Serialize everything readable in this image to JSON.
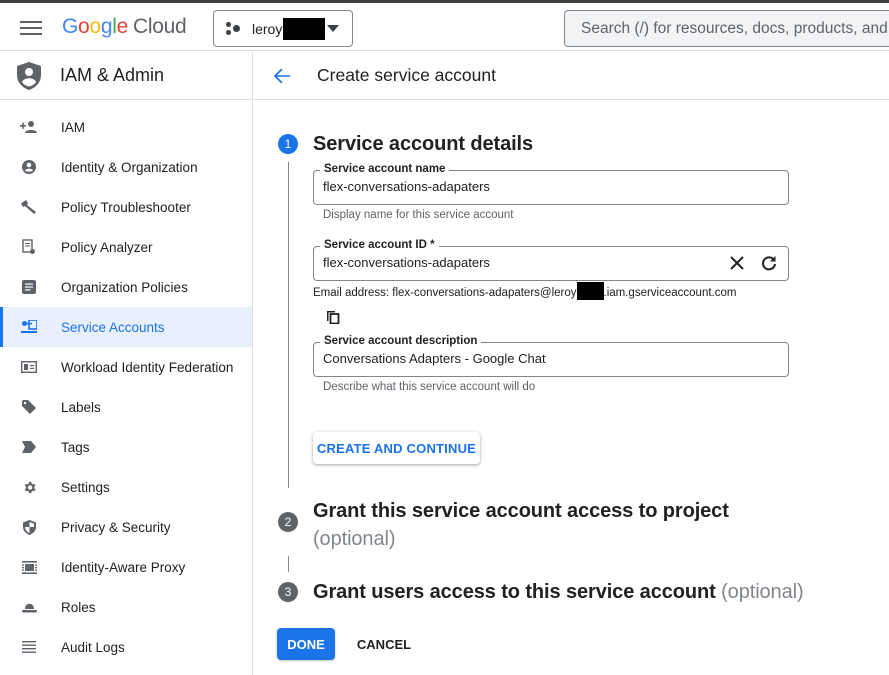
{
  "topbar": {
    "logo": {
      "part1": "G",
      "part2": "o",
      "part3": "o",
      "part4": "g",
      "part5": "l",
      "part6": "e",
      "product": "Cloud"
    },
    "project_name": "leroy",
    "search_placeholder": "Search (/) for resources, docs, products, and more"
  },
  "sidebar": {
    "title": "IAM & Admin",
    "items": [
      {
        "label": "IAM",
        "icon": "person-add-icon",
        "active": false
      },
      {
        "label": "Identity & Organization",
        "icon": "account-circle-icon",
        "active": false
      },
      {
        "label": "Policy Troubleshooter",
        "icon": "wrench-icon",
        "active": false
      },
      {
        "label": "Policy Analyzer",
        "icon": "document-search-icon",
        "active": false
      },
      {
        "label": "Organization Policies",
        "icon": "list-document-icon",
        "active": false
      },
      {
        "label": "Service Accounts",
        "icon": "service-account-icon",
        "active": true
      },
      {
        "label": "Workload Identity Federation",
        "icon": "id-card-icon",
        "active": false
      },
      {
        "label": "Labels",
        "icon": "label-tag-icon",
        "active": false
      },
      {
        "label": "Tags",
        "icon": "tag-arrow-icon",
        "active": false
      },
      {
        "label": "Settings",
        "icon": "gear-icon",
        "active": false
      },
      {
        "label": "Privacy & Security",
        "icon": "shield-icon",
        "active": false
      },
      {
        "label": "Identity-Aware Proxy",
        "icon": "proxy-icon",
        "active": false
      },
      {
        "label": "Roles",
        "icon": "hat-icon",
        "active": false
      },
      {
        "label": "Audit Logs",
        "icon": "list-lines-icon",
        "active": false
      }
    ]
  },
  "header": {
    "title": "Create service account"
  },
  "steps": [
    {
      "number": "1",
      "title": "Service account details",
      "optional": ""
    },
    {
      "number": "2",
      "title": "Grant this service account access to project",
      "optional": "(optional)"
    },
    {
      "number": "3",
      "title": "Grant users access to this service account",
      "optional": "(optional)"
    }
  ],
  "form": {
    "name": {
      "label": "Service account name",
      "value": "flex-conversations-adapaters",
      "hint": "Display name for this service account"
    },
    "id": {
      "label": "Service account ID *",
      "value": "flex-conversations-adapaters"
    },
    "email": {
      "prefix": "Email address: flex-conversations-adapaters@leroy",
      "suffix": ".iam.gserviceaccount.com"
    },
    "description": {
      "label": "Service account description",
      "value": "Conversations Adapters - Google Chat",
      "hint": "Describe what this service account will do"
    }
  },
  "buttons": {
    "create_continue": "CREATE AND CONTINUE",
    "done": "DONE",
    "cancel": "CANCEL"
  },
  "colors": {
    "accent": "#1a73e8",
    "active_bg": "#e8f0fe",
    "inactive_step": "#5f6368"
  }
}
